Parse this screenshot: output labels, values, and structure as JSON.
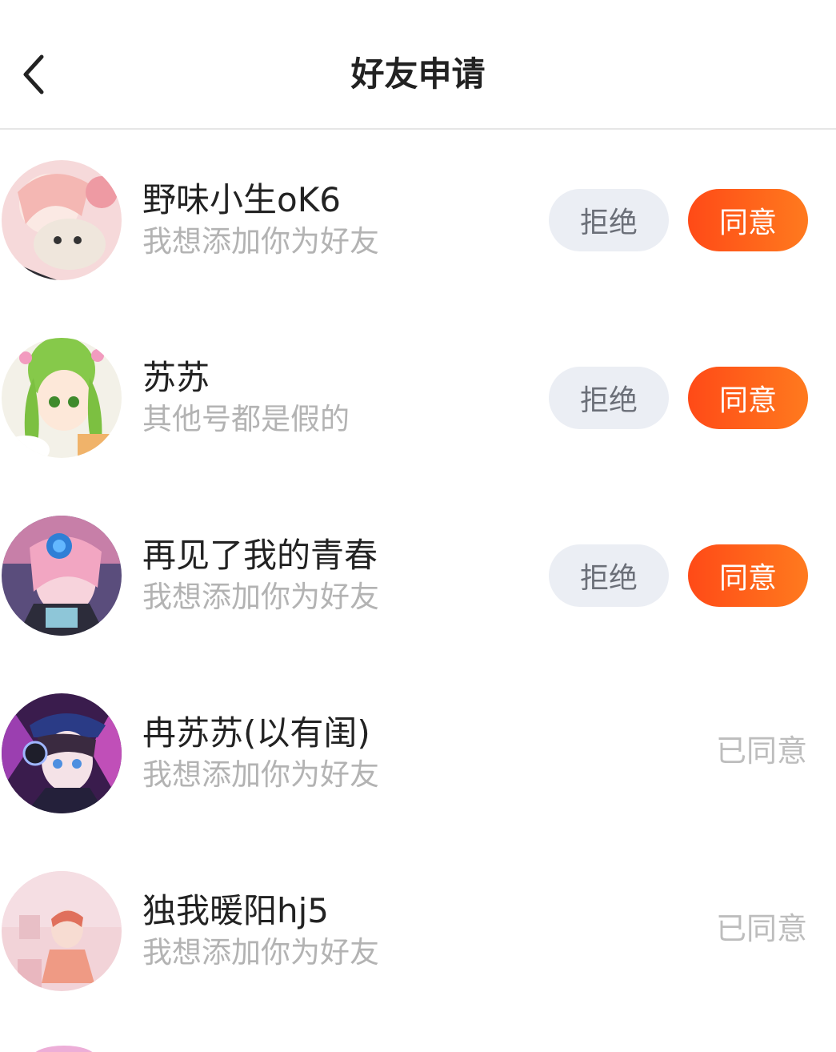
{
  "header": {
    "title": "好友申请",
    "back_icon": "chevron-left-icon"
  },
  "actions": {
    "reject_label": "拒绝",
    "accept_label": "同意",
    "accepted_label": "已同意"
  },
  "colors": {
    "accent_start": "#ff4a17",
    "accent_end": "#ff7a1e",
    "reject_bg": "#ebeef4",
    "secondary_text": "#b3b3b3"
  },
  "requests": [
    {
      "name": "野味小生oK6",
      "message": "我想添加你为好友",
      "status": "pending"
    },
    {
      "name": "苏苏",
      "message": "其他号都是假的",
      "status": "pending"
    },
    {
      "name": "再见了我的青春",
      "message": "我想添加你为好友",
      "status": "pending"
    },
    {
      "name": "冉苏苏(以有闺)",
      "message": "我想添加你为好友",
      "status": "accepted"
    },
    {
      "name": "独我暖阳hj5",
      "message": "我想添加你为好友",
      "status": "accepted"
    }
  ]
}
